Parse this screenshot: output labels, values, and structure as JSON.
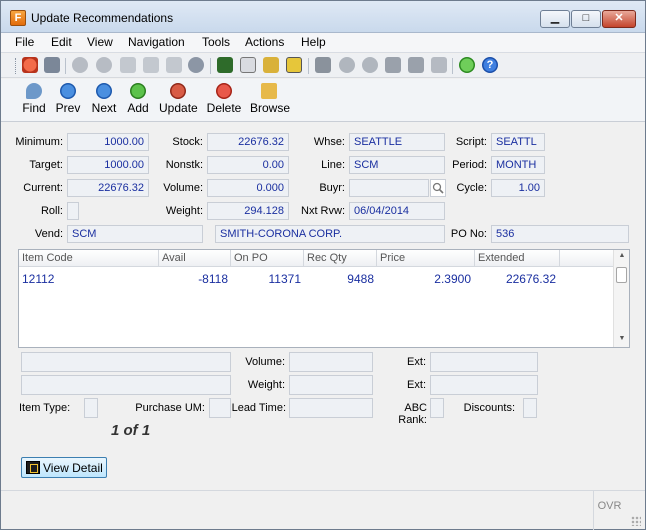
{
  "window": {
    "title": "Update Recommendations"
  },
  "menu": [
    "File",
    "Edit",
    "View",
    "Navigation",
    "Tools",
    "Actions",
    "Help"
  ],
  "toolbar_icons": [
    "power-icon",
    "copy-window-icon",
    "check-icon",
    "cancel-icon",
    "copy-icon",
    "paste-icon",
    "cut-icon",
    "find-icon",
    "clipboard-icon",
    "document-icon",
    "edit-icon",
    "checklist-icon",
    "export-icon",
    "down-icon",
    "up-icon",
    "move-left-icon",
    "move-right-icon",
    "delete-icon",
    "chart-icon",
    "help-icon"
  ],
  "nav": {
    "find": "Find",
    "prev": "Prev",
    "next": "Next",
    "add": "Add",
    "update": "Update",
    "delete": "Delete",
    "browse": "Browse"
  },
  "form": {
    "minimum_label": "Minimum:",
    "minimum": "1000.00",
    "target_label": "Target:",
    "target": "1000.00",
    "current_label": "Current:",
    "current": "22676.32",
    "roll_label": "Roll:",
    "stock_label": "Stock:",
    "stock": "22676.32",
    "nonstk_label": "Nonstk:",
    "nonstk": "0.00",
    "volume_label": "Volume:",
    "volume": "0.000",
    "weight_label": "Weight:",
    "weight": "294.128",
    "whse_label": "Whse:",
    "whse": "SEATTLE",
    "line_label": "Line:",
    "line": "SCM",
    "buyr_label": "Buyr:",
    "buyr": "",
    "nxtrvw_label": "Nxt Rvw:",
    "nxtrvw": "06/04/2014",
    "script_label": "Script:",
    "script": "SEATTL",
    "period_label": "Period:",
    "period": "MONTH",
    "cycle_label": "Cycle:",
    "cycle": "1.00",
    "vend_label": "Vend:",
    "vend": "SCM",
    "vend_name": "SMITH-CORONA CORP.",
    "pono_label": "PO No:",
    "pono": "536"
  },
  "grid": {
    "columns": [
      "Item Code",
      "Avail",
      "On PO",
      "Rec Qty",
      "Price",
      "Extended"
    ],
    "rows": [
      {
        "item_code": "12112",
        "avail": "-8118",
        "on_po": "11371",
        "rec_qty": "9488",
        "price": "2.3900",
        "extended": "22676.32"
      }
    ]
  },
  "detail": {
    "volume_label": "Volume:",
    "weight_label": "Weight:",
    "ext_label": "Ext:",
    "item_type_label": "Item Type:",
    "purchase_um_label": "Purchase UM:",
    "lead_time_label": "Lead Time:",
    "abc_rank_label": "ABC Rank:",
    "discounts_label": "Discounts:"
  },
  "pager": "1 of 1",
  "view_detail": "View Detail",
  "status": {
    "ovr": "OVR"
  }
}
